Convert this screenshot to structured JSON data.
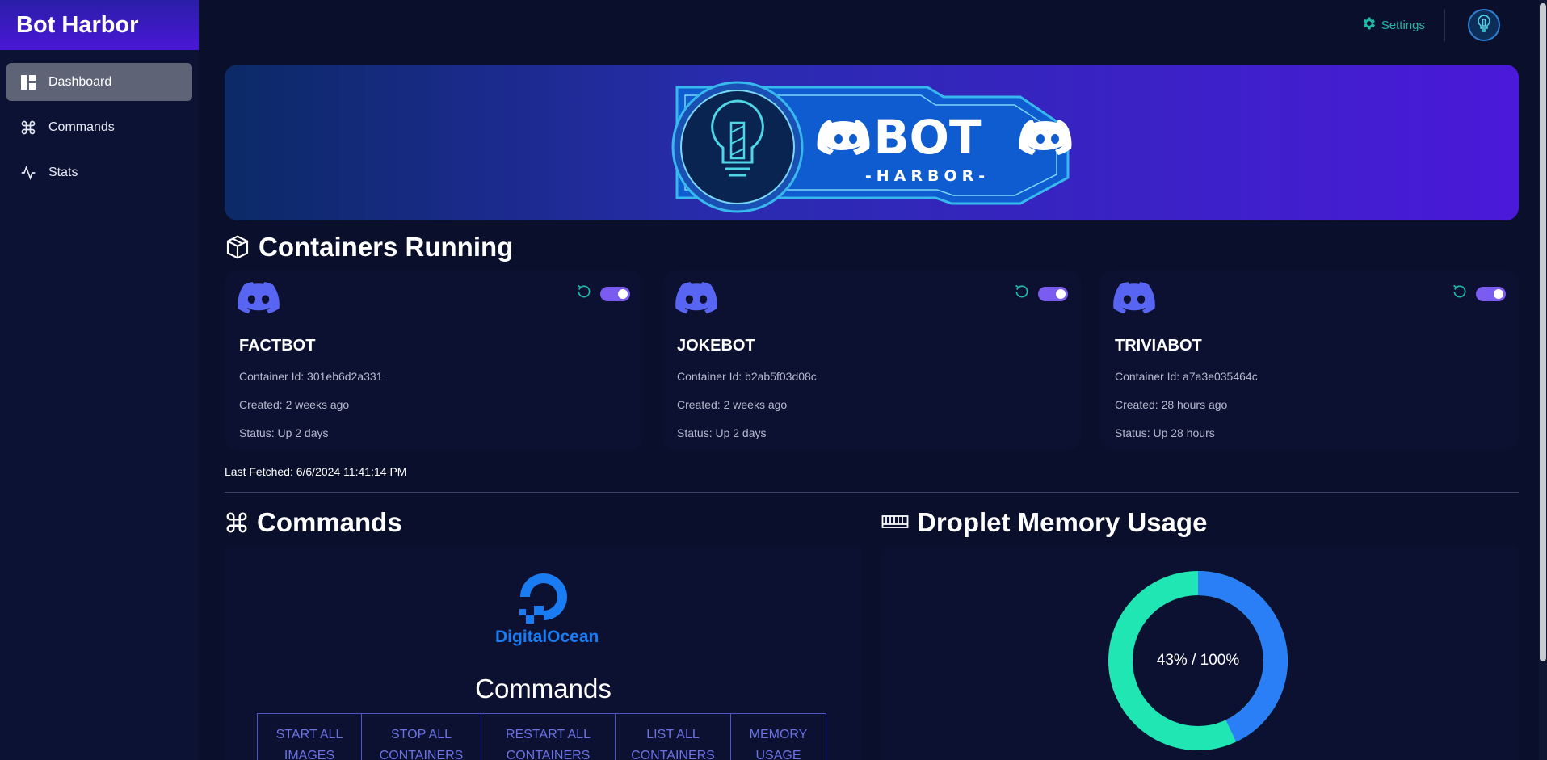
{
  "app": {
    "brand": "Bot Harbor"
  },
  "sidebar": {
    "items": [
      {
        "label": "Dashboard",
        "icon": "dashboard-icon",
        "active": true
      },
      {
        "label": "Commands",
        "icon": "command-icon",
        "active": false
      },
      {
        "label": "Stats",
        "icon": "activity-icon",
        "active": false
      }
    ]
  },
  "topbar": {
    "settings_label": "Settings",
    "settings_icon": "gear-icon",
    "avatar_icon": "lighthouse-bulb-icon"
  },
  "banner": {
    "logo_word": "BOT",
    "logo_sub": "-HARBOR-"
  },
  "containers": {
    "title": "Containers Running",
    "items": [
      {
        "name": "FACTBOT",
        "container_id": "Container Id: 301eb6d2a331",
        "created": "Created: 2 weeks ago",
        "status": "Status: Up 2 days",
        "enabled": true
      },
      {
        "name": "JOKEBOT",
        "container_id": "Container Id: b2ab5f03d08c",
        "created": "Created: 2 weeks ago",
        "status": "Status: Up 2 days",
        "enabled": true
      },
      {
        "name": "TRIVIABOT",
        "container_id": "Container Id: a7a3e035464c",
        "created": "Created: 28 hours ago",
        "status": "Status: Up 28 hours",
        "enabled": true
      }
    ],
    "last_fetched": "Last Fetched: 6/6/2024 11:41:14 PM"
  },
  "commands": {
    "title": "Commands",
    "provider": "DigitalOcean",
    "panel_title": "Commands",
    "buttons": [
      {
        "line1": "START ALL",
        "line2": "IMAGES"
      },
      {
        "line1": "STOP ALL",
        "line2": "CONTAINERS"
      },
      {
        "line1": "RESTART ALL",
        "line2": "CONTAINERS"
      },
      {
        "line1": "LIST ALL",
        "line2": "CONTAINERS"
      },
      {
        "line1": "MEMORY",
        "line2": "USAGE"
      }
    ]
  },
  "memory": {
    "title": "Droplet Memory Usage",
    "label": "43% / 100%",
    "used_fraction": 0.43,
    "used_color": "#2a7ff6",
    "free_color": "#1fe6b2"
  },
  "colors": {
    "accent": "#4a17d6",
    "teal": "#1fb9a6",
    "discord": "#5865f2",
    "toggle": "#7b5cf0"
  }
}
